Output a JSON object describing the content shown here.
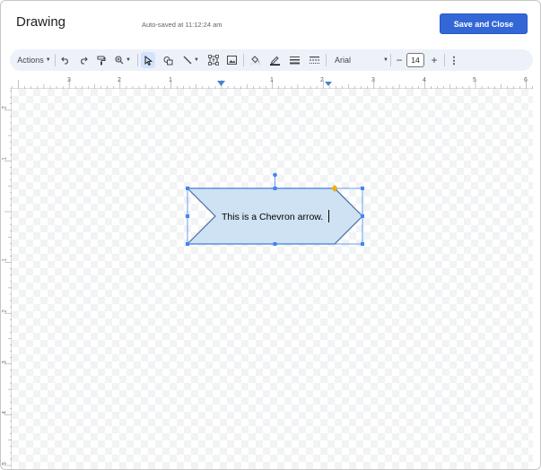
{
  "header": {
    "title": "Drawing",
    "autosave": "Auto-saved at 11:12:24 am",
    "save_button": "Save and Close"
  },
  "toolbar": {
    "actions_label": "Actions",
    "font_family": "Arial",
    "font_size": "14",
    "icons": [
      "undo-icon",
      "redo-icon",
      "paint-format-icon",
      "zoom-icon",
      "select-icon",
      "shape-icon",
      "line-icon",
      "textbox-icon",
      "image-icon",
      "fill-color-icon",
      "border-color-icon",
      "border-weight-icon",
      "border-dash-icon",
      "decrease-size-icon",
      "increase-size-icon",
      "more-options-icon"
    ]
  },
  "ruler": {
    "top_numbers": [
      "3",
      "2",
      "1",
      "1",
      "2",
      "3",
      "4",
      "5",
      "6"
    ],
    "left_numbers": [
      "2",
      "1",
      "1",
      "2",
      "3",
      "4",
      "5"
    ]
  },
  "shape": {
    "type": "chevron",
    "text": "This is a Chevron arrow."
  },
  "colors": {
    "accent": "#3367d6",
    "shape_fill": "#cfe2f3",
    "shape_border": "#4a6e9c",
    "selection": "#4285f4",
    "adjust_handle": "#f4b400"
  }
}
